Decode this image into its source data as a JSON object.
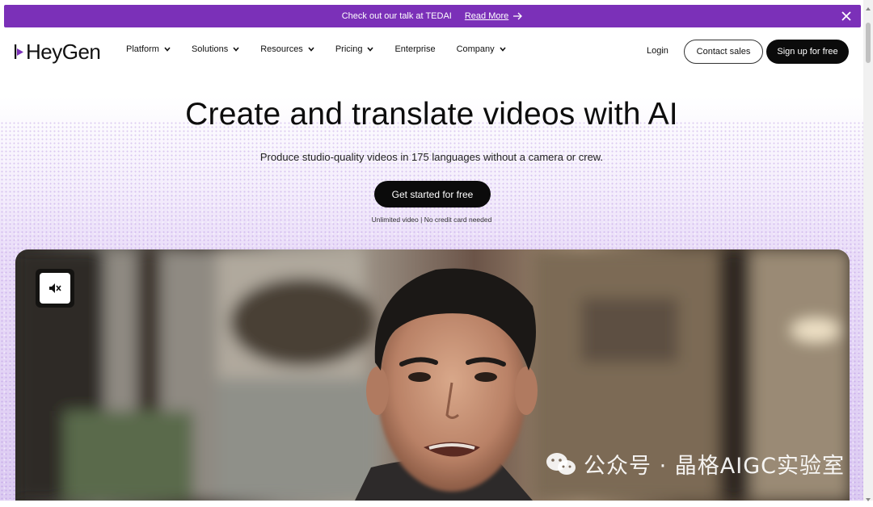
{
  "banner": {
    "text": "Check out our talk at TEDAI",
    "link_label": "Read More"
  },
  "nav": {
    "logo_text": "HeyGen",
    "menu": [
      {
        "label": "Platform",
        "dropdown": true
      },
      {
        "label": "Solutions",
        "dropdown": true
      },
      {
        "label": "Resources",
        "dropdown": true
      },
      {
        "label": "Pricing",
        "dropdown": true
      },
      {
        "label": "Enterprise",
        "dropdown": false
      },
      {
        "label": "Company",
        "dropdown": true
      }
    ],
    "login_label": "Login",
    "contact_label": "Contact sales",
    "signup_label": "Sign up for free"
  },
  "hero": {
    "title": "Create and translate videos with AI",
    "subtitle": "Produce studio-quality videos in 175 languages without a camera or crew.",
    "cta_label": "Get started for free",
    "cta_note": "Unlimited video | No credit card needed"
  },
  "video": {
    "mute_icon": "speaker-muted-icon"
  },
  "watermark": {
    "text": "公众号 · 晶格AIGC实验室"
  },
  "colors": {
    "banner_bg": "#7b30b8",
    "dark_button": "#0b0b0b",
    "logo_accent": "#7b30b8"
  }
}
